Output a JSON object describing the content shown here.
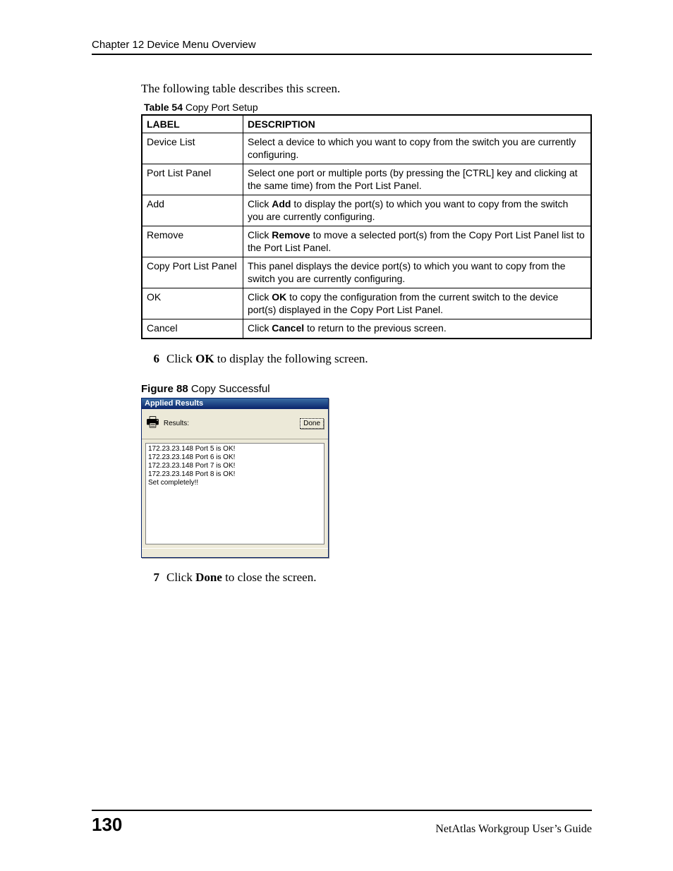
{
  "header": {
    "chapter": "Chapter 12 Device Menu Overview"
  },
  "intro": "The following table describes this screen.",
  "table_caption": {
    "bold": "Table 54",
    "rest": "   Copy Port Setup"
  },
  "table": {
    "head": {
      "label": "LABEL",
      "desc": "DESCRIPTION"
    },
    "rows": [
      {
        "label": "Device List",
        "desc_plain": "Select a device to which you want to copy from the switch you are currently configuring."
      },
      {
        "label": "Port List Panel",
        "desc_plain": "Select one port or multiple ports (by pressing the [CTRL] key and clicking at the same time) from the Port List Panel."
      },
      {
        "label": "Add",
        "pre": "Click ",
        "bold": "Add",
        "post": " to display the port(s) to which you want to copy from the switch you are currently configuring."
      },
      {
        "label": "Remove",
        "pre": "Click ",
        "bold": "Remove",
        "post": " to move a selected port(s) from the Copy Port List Panel list to the Port List Panel."
      },
      {
        "label": "Copy Port List Panel",
        "desc_plain": "This panel displays the device port(s) to which you want to copy from the switch you are currently configuring."
      },
      {
        "label": "OK",
        "pre": "Click ",
        "bold": "OK",
        "post": " to copy the configuration from the current switch to the device port(s) displayed in the Copy Port List Panel."
      },
      {
        "label": "Cancel",
        "pre": "Click ",
        "bold": "Cancel",
        "post": " to return to the previous screen."
      }
    ]
  },
  "step6": {
    "num": "6",
    "pre": "Click ",
    "bold": "OK",
    "post": " to display the following screen."
  },
  "figure_caption": {
    "bold": "Figure 88",
    "rest": "   Copy Successful"
  },
  "dialog": {
    "title": "Applied Results",
    "results_label": "Results:",
    "done": "Done",
    "lines": [
      "172.23.23.148 Port 5 is OK!",
      "172.23.23.148 Port 6 is OK!",
      "172.23.23.148 Port 7 is OK!",
      "172.23.23.148 Port 8 is OK!",
      "Set completely!!"
    ]
  },
  "step7": {
    "num": "7",
    "pre": "Click ",
    "bold": "Done",
    "post": " to close the screen."
  },
  "footer": {
    "page": "130",
    "guide": "NetAtlas Workgroup User’s Guide"
  }
}
